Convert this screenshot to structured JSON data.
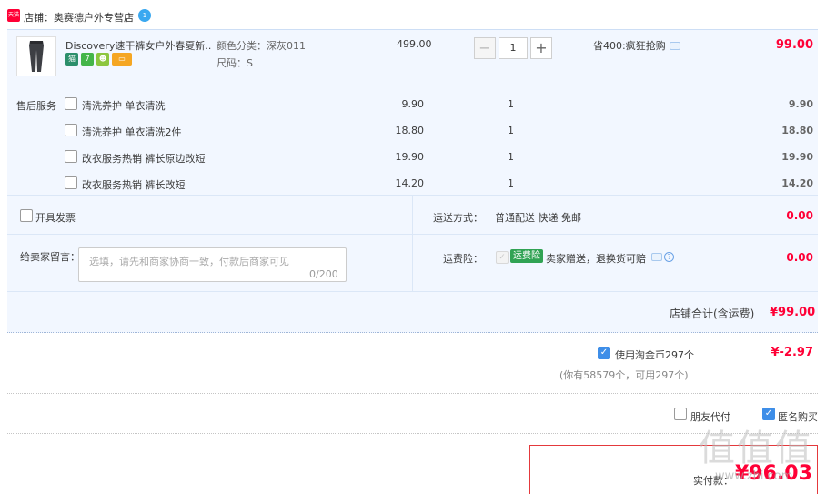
{
  "shop": {
    "icon_text": "天猫",
    "label": "店铺：奥赛德户外专营店",
    "badge_text": "1"
  },
  "product": {
    "title": "Discovery速干裤女户外春夏新...",
    "badges": [
      {
        "name": "tmall-badge",
        "text": "猫",
        "color": "#2c8f6b"
      },
      {
        "name": "seven-day-badge",
        "text": "7",
        "color": "#44b549"
      },
      {
        "name": "credit-badge",
        "text": "☻",
        "color": "#8cc63f"
      },
      {
        "name": "card-badge",
        "text": "▭",
        "color": "#f5a623"
      }
    ],
    "attr_color": "颜色分类：深灰011",
    "attr_size": "尺码：S",
    "unit_price": "499.00",
    "quantity": "1",
    "minus_label": "−",
    "plus_label": "+",
    "promo": "省400:疯狂抢购",
    "total": "99.00"
  },
  "services": {
    "title": "售后服务",
    "items": [
      {
        "name": "清洗养护 单衣清洗",
        "price": "9.90",
        "qty": "1",
        "total": "9.90",
        "checked": false
      },
      {
        "name": "清洗养护 单衣清洗2件",
        "price": "18.80",
        "qty": "1",
        "total": "18.80",
        "checked": false
      },
      {
        "name": "改衣服务热销 裤长原边改短",
        "price": "19.90",
        "qty": "1",
        "total": "19.90",
        "checked": false
      },
      {
        "name": "改衣服务热销 裤长改短",
        "price": "14.20",
        "qty": "1",
        "total": "14.20",
        "checked": false
      }
    ]
  },
  "invoice": {
    "label": "开具发票",
    "checked": false
  },
  "shipping": {
    "label": "运送方式：",
    "value": "普通配送 快递 免邮",
    "cost": "0.00"
  },
  "message": {
    "label": "给卖家留言：",
    "placeholder": "选填，请先和商家协商一致，付款后商家可见",
    "count": "0/200"
  },
  "insurance": {
    "label": "运费险：",
    "tag": "运费险",
    "text": "卖家赠送，退换货可赔",
    "cost": "0.00",
    "help": "?"
  },
  "shop_total": {
    "label": "店铺合计(含运费)",
    "value": "¥99.00"
  },
  "coins": {
    "label": "使用淘金币297个",
    "value": "¥-2.97",
    "note": "(你有58579个，可用297个)",
    "checked": true
  },
  "options": {
    "friend_pay": "朋友代付",
    "friend_checked": false,
    "anonymous": "匿名购买",
    "anonymous_checked": true
  },
  "payment": {
    "label": "实付款：",
    "value": "¥96.03"
  },
  "watermark": {
    "text": "值值值",
    "url": "www.zhi.com"
  },
  "colors": {
    "accent_red": "#ff0036",
    "panel_blue": "#f2f7ff",
    "check_blue": "#3e8ee8",
    "insurance_green": "#31a354"
  }
}
